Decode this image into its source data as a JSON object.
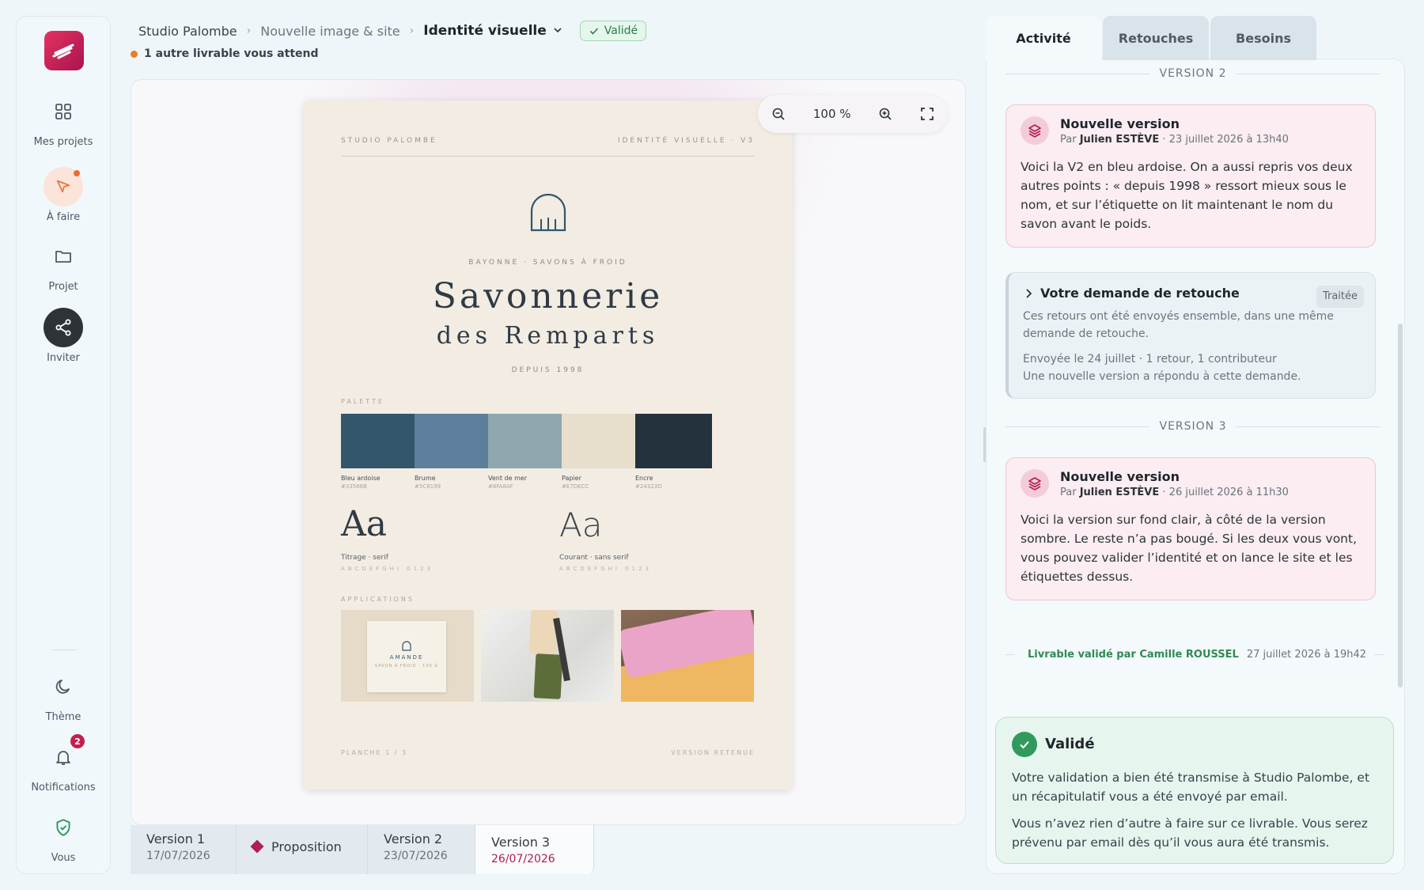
{
  "sidebar": {
    "items": [
      {
        "label": "Mes projets",
        "icon": "grid-icon"
      },
      {
        "label": "À faire",
        "icon": "cursor-icon"
      },
      {
        "label": "Projet",
        "icon": "folder-icon"
      },
      {
        "label": "Inviter",
        "icon": "share-icon"
      }
    ],
    "bottom": [
      {
        "label": "Thème",
        "icon": "moon-icon"
      },
      {
        "label": "Notifications",
        "icon": "bell-icon",
        "badge": "2"
      },
      {
        "label": "Vous",
        "icon": "shield-check-icon"
      }
    ]
  },
  "header": {
    "breadcrumb": [
      "Studio Palombe",
      "Nouvelle image & site"
    ],
    "current": "Identité visuelle",
    "status": "Validé",
    "pending": "1 autre livrable vous attend"
  },
  "viewer": {
    "zoom": "100 %",
    "doc": {
      "studio": "STUDIO PALOMBE",
      "ident": "IDENTITÉ VISUELLE · V3",
      "subtitle": "BAYONNE · SAVONS À FROID",
      "title1": "Savonnerie",
      "title2": "des Remparts",
      "since": "DEPUIS 1998",
      "palette_label": "PALETTE",
      "swatches": [
        {
          "name": "Bleu ardoise",
          "hex": "#33566B",
          "color": "#33566b"
        },
        {
          "name": "Brume",
          "hex": "#5C8199",
          "color": "#5e7f9b"
        },
        {
          "name": "Vent de mer",
          "hex": "#8FA8AF",
          "color": "#8fa8af"
        },
        {
          "name": "Papier",
          "hex": "#E7DECC",
          "color": "#e7decc"
        },
        {
          "name": "Encre",
          "hex": "#24323D",
          "color": "#24323d"
        }
      ],
      "aa": "Aa",
      "font1_label": "Titrage · serif",
      "font2_label": "Courant · sans serif",
      "alphabet": "ABCDEFGHI 0123",
      "applications_label": "APPLICATIONS",
      "label_name": "AMANDE",
      "label_sub": "SAVON À FROID · 100 G",
      "footer_left": "PLANCHE 1 / 3",
      "footer_right": "VERSION RETENUE"
    }
  },
  "versions": [
    {
      "label": "Version 1",
      "date": "17/07/2026"
    },
    {
      "label": "Proposition"
    },
    {
      "label": "Version 2",
      "date": "23/07/2026"
    },
    {
      "label": "Version 3",
      "date": "26/07/2026"
    }
  ],
  "panel": {
    "tabs": [
      "Activité",
      "Retouches",
      "Besoins"
    ],
    "v2_sep": "VERSION 2",
    "v3_sep": "VERSION 3",
    "card1": {
      "title": "Nouvelle version",
      "by": "Par",
      "author": "Julien ESTÈVE",
      "date": "· 23 juillet 2026 à 13h40",
      "text": "Voici la V2 en bleu ardoise. On a aussi repris vos deux autres points : « depuis 1998 » ressort mieux sous le nom, et sur l’étiquette on lit maintenant le nom du savon avant le poids."
    },
    "retouche": {
      "title": "Votre demande de retouche",
      "tag": "Traitée",
      "desc": "Ces retours ont été envoyés ensemble, dans une même demande de retouche.",
      "sent": "Envoyée le 24 juillet · 1 retour, 1 contributeur",
      "answered": "Une nouvelle version a répondu à cette demande."
    },
    "card2": {
      "title": "Nouvelle version",
      "by": "Par",
      "author": "Julien ESTÈVE",
      "date": "· 26 juillet 2026 à 11h30",
      "text": "Voici la version sur fond clair, à côté de la version sombre. Le reste n’a pas bougé. Si les deux vous vont, vous pouvez valider l’identité et on lance le site et les étiquettes dessus."
    },
    "validated": {
      "text": "Livrable validé par Camille ROUSSEL",
      "date": "27 juillet 2026 à 19h42"
    },
    "valcard": {
      "title": "Validé",
      "p1": "Votre validation a bien été transmise à Studio Palombe, et un récapitulatif vous a été envoyé par email.",
      "p2": "Vous n’avez rien d’autre à faire sur ce livrable. Vous serez prévenu par email dès qu’il vous aura été transmis."
    }
  }
}
